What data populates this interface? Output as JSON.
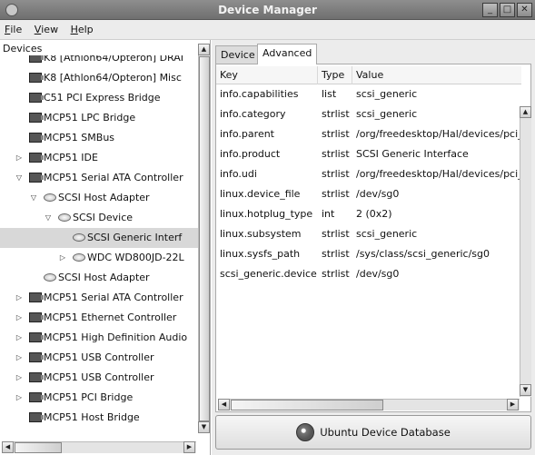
{
  "window": {
    "title": "Device Manager"
  },
  "menu": [
    {
      "mnemonic": "F",
      "rest": "ile"
    },
    {
      "mnemonic": "V",
      "rest": "iew"
    },
    {
      "mnemonic": "H",
      "rest": "elp"
    }
  ],
  "tree": {
    "header": "Devices",
    "items": [
      {
        "label": "K8 [Athlon64/Opteron] DRAI",
        "icon": "pc-card-icon",
        "indent": 2,
        "expander": ""
      },
      {
        "label": "K8 [Athlon64/Opteron] Misc",
        "icon": "pc-card-icon",
        "indent": 2,
        "expander": ""
      },
      {
        "label": "C51 PCI Express Bridge",
        "icon": "pc-card-icon",
        "indent": 2,
        "expander": ""
      },
      {
        "label": "MCP51 LPC Bridge",
        "icon": "pc-card-icon",
        "indent": 2,
        "expander": ""
      },
      {
        "label": "MCP51 SMBus",
        "icon": "pc-card-icon",
        "indent": 2,
        "expander": ""
      },
      {
        "label": "MCP51 IDE",
        "icon": "pc-card-icon",
        "indent": 2,
        "expander": "collapsed"
      },
      {
        "label": "MCP51 Serial ATA Controller",
        "icon": "pc-card-icon",
        "indent": 2,
        "expander": "expanded"
      },
      {
        "label": "SCSI Host Adapter",
        "icon": "disk-icon",
        "indent": 3,
        "expander": "expanded"
      },
      {
        "label": "SCSI Device",
        "icon": "disk-icon",
        "indent": 4,
        "expander": "expanded"
      },
      {
        "label": "SCSI Generic Interf",
        "icon": "disk-icon",
        "indent": 5,
        "expander": "",
        "selected": true
      },
      {
        "label": "WDC WD800JD-22L",
        "icon": "disk-icon",
        "indent": 5,
        "expander": "collapsed"
      },
      {
        "label": "SCSI Host Adapter",
        "icon": "disk-icon",
        "indent": 3,
        "expander": ""
      },
      {
        "label": "MCP51 Serial ATA Controller",
        "icon": "pc-card-icon",
        "indent": 2,
        "expander": "collapsed"
      },
      {
        "label": "MCP51 Ethernet Controller",
        "icon": "pc-card-icon",
        "indent": 2,
        "expander": "collapsed"
      },
      {
        "label": "MCP51 High Definition Audio",
        "icon": "pc-card-icon",
        "indent": 2,
        "expander": "collapsed"
      },
      {
        "label": "MCP51 USB Controller",
        "icon": "pc-card-icon",
        "indent": 2,
        "expander": "collapsed"
      },
      {
        "label": "MCP51 USB Controller",
        "icon": "pc-card-icon",
        "indent": 2,
        "expander": "collapsed"
      },
      {
        "label": "MCP51 PCI Bridge",
        "icon": "pc-card-icon",
        "indent": 2,
        "expander": "collapsed"
      },
      {
        "label": "MCP51 Host Bridge",
        "icon": "pc-card-icon",
        "indent": 2,
        "expander": ""
      }
    ]
  },
  "tabs": [
    {
      "label": "Device",
      "active": false
    },
    {
      "label": "Advanced",
      "active": true
    }
  ],
  "properties": {
    "columns": [
      "Key",
      "Type",
      "Value"
    ],
    "rows": [
      {
        "key": "info.capabilities",
        "type": "list",
        "value": "scsi_generic"
      },
      {
        "key": "info.category",
        "type": "strlist",
        "value": "scsi_generic"
      },
      {
        "key": "info.parent",
        "type": "strlist",
        "value": "/org/freedesktop/Hal/devices/pci_"
      },
      {
        "key": "info.product",
        "type": "strlist",
        "value": "SCSI Generic Interface"
      },
      {
        "key": "info.udi",
        "type": "strlist",
        "value": "/org/freedesktop/Hal/devices/pci_"
      },
      {
        "key": "linux.device_file",
        "type": "strlist",
        "value": "/dev/sg0"
      },
      {
        "key": "linux.hotplug_type",
        "type": "int",
        "value": "2 (0x2)"
      },
      {
        "key": "linux.subsystem",
        "type": "strlist",
        "value": "scsi_generic"
      },
      {
        "key": "linux.sysfs_path",
        "type": "strlist",
        "value": "/sys/class/scsi_generic/sg0"
      },
      {
        "key": "scsi_generic.device",
        "type": "strlist",
        "value": "/dev/sg0"
      }
    ]
  },
  "database_button": {
    "label": "Ubuntu Device Database",
    "icon": "ubuntu-logo-icon"
  }
}
